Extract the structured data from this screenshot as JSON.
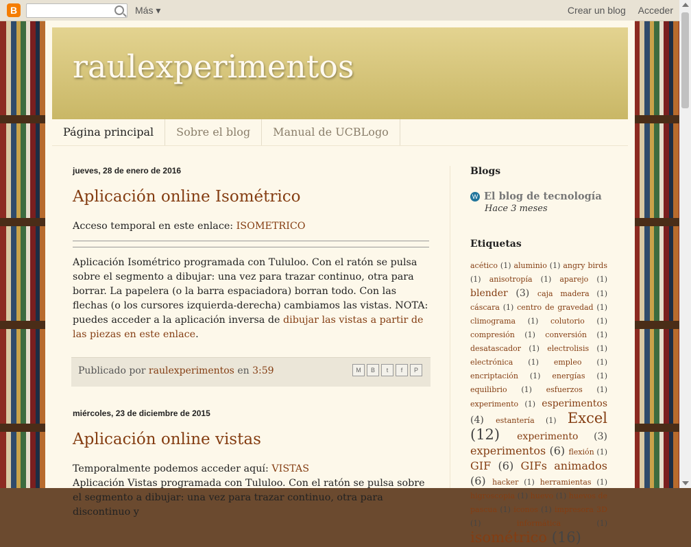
{
  "navbar": {
    "search_value": "",
    "more_label": "Más ▾",
    "create_blog": "Crear un blog",
    "sign_in": "Acceder",
    "blogger_logo": "B"
  },
  "blog": {
    "title": "raulexperimentos"
  },
  "tabs": [
    {
      "label": "Página principal"
    },
    {
      "label": "Sobre el blog"
    },
    {
      "label": "Manual de UCBLogo"
    }
  ],
  "posts": [
    {
      "date": "jueves, 28 de enero de 2016",
      "title": "Aplicación online Isométrico",
      "link_prefix": "Acceso temporal en este enlace: ",
      "link_text": "ISOMETRICO",
      "body": "Aplicación Isométrico programada con Tululoo. Con el ratón se pulsa sobre el segmento a dibujar: una vez para trazar continuo, otra para borrar. La papelera (o la barra espaciadora) borran todo. Con las flechas (o los cursores izquierda-derecha) cambiamos las vistas. NOTA: puedes acceder a la aplicación inversa de ",
      "body_link": "dibujar las vistas a partir de las piezas en este enlace",
      "body_end": ".",
      "footer_prefix": "Publicado por ",
      "author": "raulexperimentos",
      "footer_mid": " en ",
      "time": "3:59"
    },
    {
      "date": "miércoles, 23 de diciembre de 2015",
      "title": "Aplicación online vistas",
      "link_prefix": "Temporalmente podemos acceder aquí: ",
      "link_text": "VISTAS",
      "body": "Aplicación Vistas programada con Tululoo. Con el ratón se pulsa sobre el segmento a dibujar: una vez para trazar continuo, otra para discontinuo y"
    }
  ],
  "share_icons": [
    "M",
    "B",
    "t",
    "f",
    "P"
  ],
  "sidebar": {
    "blogs_title": "Blogs",
    "blog_item": "El blog de tecnología",
    "blog_item_time": "Hace 3 meses",
    "labels_title": "Etiquetas",
    "labels": [
      {
        "t": "acético",
        "c": "(1)",
        "s": 11
      },
      {
        "t": "aluminio",
        "c": "(1)",
        "s": 11
      },
      {
        "t": "angry birds",
        "c": "(1)",
        "s": 11
      },
      {
        "t": "anisotropía",
        "c": "(1)",
        "s": 11
      },
      {
        "t": "aparejo",
        "c": "(1)",
        "s": 11
      },
      {
        "t": "blender",
        "c": "(3)",
        "s": 14
      },
      {
        "t": "caja madera",
        "c": "(1)",
        "s": 11
      },
      {
        "t": "cáscara",
        "c": "(1)",
        "s": 11
      },
      {
        "t": "centro de gravedad",
        "c": "(1)",
        "s": 11
      },
      {
        "t": "climograma",
        "c": "(1)",
        "s": 11
      },
      {
        "t": "colutorio",
        "c": "(1)",
        "s": 11
      },
      {
        "t": "compresión",
        "c": "(1)",
        "s": 11
      },
      {
        "t": "conversión",
        "c": "(1)",
        "s": 11
      },
      {
        "t": "desatascador",
        "c": "(1)",
        "s": 11
      },
      {
        "t": "electrolisis",
        "c": "(1)",
        "s": 11
      },
      {
        "t": "electrónica",
        "c": "(1)",
        "s": 11
      },
      {
        "t": "empleo",
        "c": "(1)",
        "s": 11
      },
      {
        "t": "encriptación",
        "c": "(1)",
        "s": 11
      },
      {
        "t": "energías",
        "c": "(1)",
        "s": 11
      },
      {
        "t": "equilibrio",
        "c": "(1)",
        "s": 11
      },
      {
        "t": "esfuerzos",
        "c": "(1)",
        "s": 11
      },
      {
        "t": "experimento",
        "c": "(1)",
        "s": 11
      },
      {
        "t": "esperimentos",
        "c": "(4)",
        "s": 14
      },
      {
        "t": "estantería",
        "c": "(1)",
        "s": 11
      },
      {
        "t": "Excel",
        "c": "(12)",
        "s": 21
      },
      {
        "t": "experimento",
        "c": "(3)",
        "s": 14
      },
      {
        "t": "experimentos",
        "c": "(6)",
        "s": 16
      },
      {
        "t": "flexión",
        "c": "(1)",
        "s": 11
      },
      {
        "t": "GIF",
        "c": "(6)",
        "s": 16
      },
      {
        "t": "GIFs animados",
        "c": "(6)",
        "s": 16
      },
      {
        "t": "hacker",
        "c": "(1)",
        "s": 11
      },
      {
        "t": "herramientas",
        "c": "(1)",
        "s": 11
      },
      {
        "t": "higroscopia",
        "c": "(1)",
        "s": 11
      },
      {
        "t": "huevo",
        "c": "(1)",
        "s": 11
      },
      {
        "t": "huevos de pascua",
        "c": "(1)",
        "s": 11
      },
      {
        "t": "iconos",
        "c": "(1)",
        "s": 11
      },
      {
        "t": "impresora 3D",
        "c": "(1)",
        "s": 11
      },
      {
        "t": "informática",
        "c": "(1)",
        "s": 11
      },
      {
        "t": "isométrico",
        "c": "(16)",
        "s": 21
      }
    ]
  }
}
